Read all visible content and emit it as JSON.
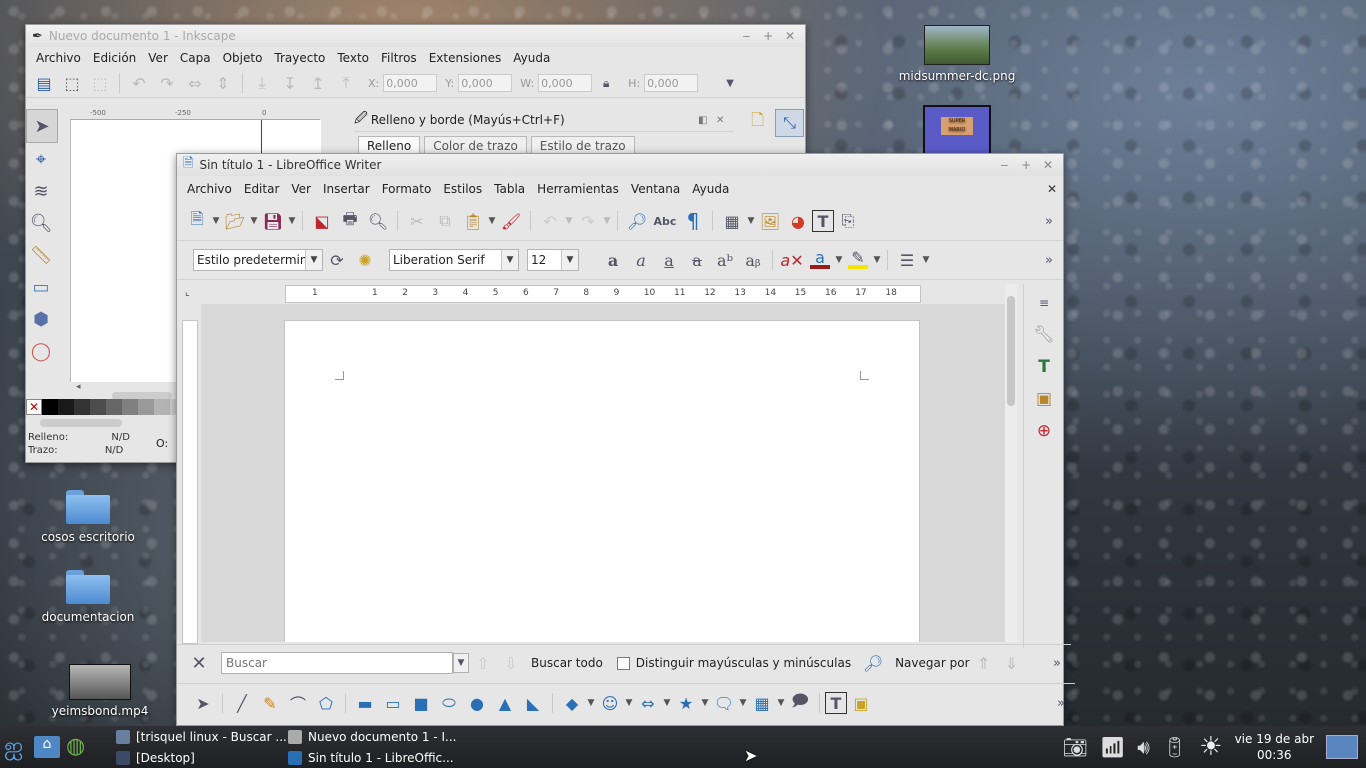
{
  "desktop": {
    "icons": [
      {
        "label": "midsummer-dc.png"
      },
      {
        "label": "cosos escritorio"
      },
      {
        "label": "documentacion"
      },
      {
        "label": "yeimsbond.mp4"
      }
    ],
    "mario_label": "SUPER MARIO BROS."
  },
  "inkscape": {
    "title": "Nuevo documento 1 - Inkscape",
    "menu": [
      "Archivo",
      "Edición",
      "Ver",
      "Capa",
      "Objeto",
      "Trayecto",
      "Texto",
      "Filtros",
      "Extensiones",
      "Ayuda"
    ],
    "coords": {
      "x_label": "X:",
      "x_value": "0,000",
      "y_label": "Y:",
      "y_value": "0,000",
      "w_label": "W:",
      "w_value": "0,000",
      "h_label": "H:",
      "h_value": "0,000"
    },
    "ruler": [
      "-500",
      "-250",
      "0"
    ],
    "panel_title": "Relleno y borde (Mayús+Ctrl+F)",
    "panel_tabs": [
      "Relleno",
      "Color de trazo",
      "Estilo de trazo"
    ],
    "status": {
      "fill_label": "Relleno:",
      "fill_value": "N/D",
      "stroke_label": "Trazo:",
      "stroke_value": "N/D",
      "opacity_label": "O:"
    }
  },
  "writer": {
    "title": "Sin título 1 - LibreOffice Writer",
    "menu": [
      "Archivo",
      "Editar",
      "Ver",
      "Insertar",
      "Formato",
      "Estilos",
      "Tabla",
      "Herramientas",
      "Ventana",
      "Ayuda"
    ],
    "paragraph_style": "Estilo predetermina",
    "font_name": "Liberation Serif",
    "font_size": "12",
    "ruler_numbers": [
      "1",
      "1",
      "2",
      "3",
      "4",
      "5",
      "6",
      "7",
      "8",
      "9",
      "10",
      "11",
      "12",
      "13",
      "14",
      "15",
      "16",
      "17",
      "18"
    ],
    "find": {
      "placeholder": "Buscar",
      "find_all": "Buscar todo",
      "match_case": "Distinguir mayúsculas y minúsculas",
      "navigate_by": "Navegar por"
    }
  },
  "taskbar": {
    "items": [
      "[trisquel linux - Buscar ...",
      "[Desktop]",
      "Nuevo documento 1 - I...",
      "Sin título 1 - LibreOffic..."
    ],
    "clock_date": "vie 19 de abr",
    "clock_time": "00:36"
  },
  "colors": {
    "writer_accent": "#2a6fb5",
    "font_color_bar": "#9b1b1b",
    "highlight_bar": "#f5e400"
  }
}
